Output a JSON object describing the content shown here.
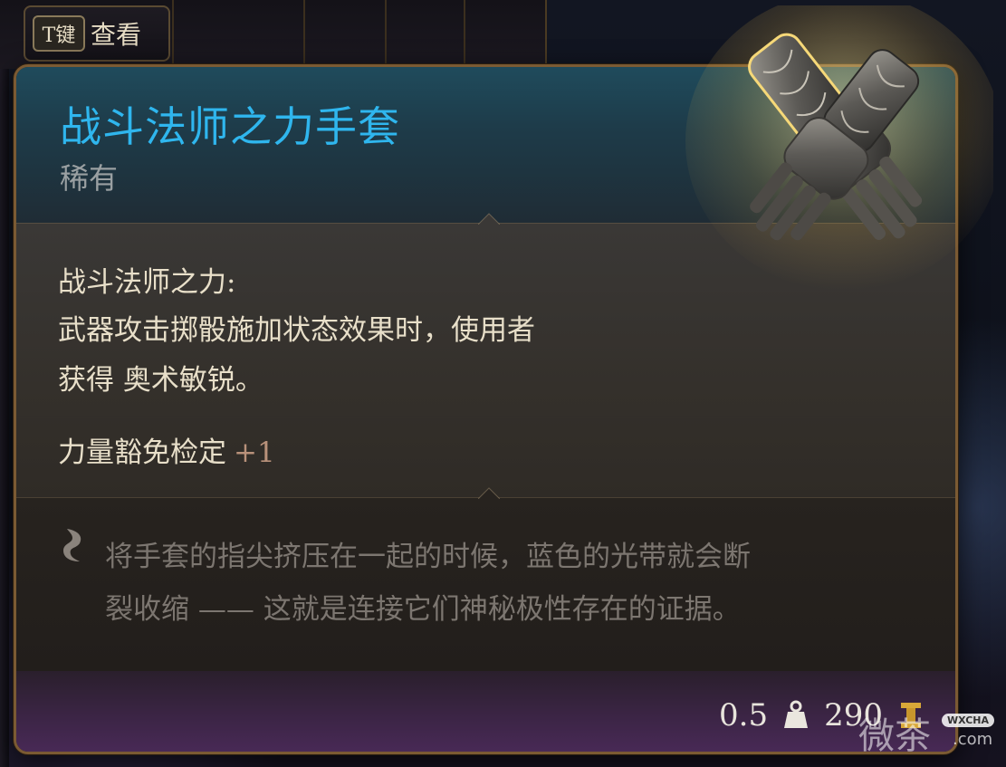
{
  "key_hint": {
    "key": "T键",
    "label": "查看"
  },
  "item": {
    "name": "战斗法师之力手套",
    "rarity": "稀有",
    "name_color": "#2fb6ee",
    "icon": "gauntlets-icon"
  },
  "effect": {
    "title": "战斗法师之力:",
    "description_line1": "武器攻击掷骰施加状态效果时，使用者",
    "description_line2": "获得 奥术敏锐。"
  },
  "stat": {
    "label": "力量豁免检定",
    "bonus": "+1"
  },
  "flavor": {
    "icon": "quill-icon",
    "line1": "将手套的指尖挤压在一起的时候，蓝色的光带就会断",
    "line2": "裂收缩 —— 这就是连接它们神秘极性存在的证据。"
  },
  "footer": {
    "weight": "0.5",
    "weight_icon": "weight-icon",
    "value": "290",
    "value_icon": "gold-coin-icon"
  },
  "watermark": {
    "chars": "微茶",
    "badge": "WXCHA",
    "domain": ".com"
  }
}
